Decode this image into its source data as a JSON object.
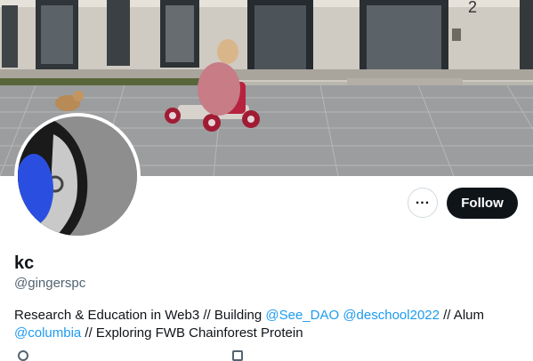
{
  "profile": {
    "display_name": "kc",
    "handle": "@gingerspc",
    "follow_label": "Follow",
    "more_label": "...",
    "bio": {
      "part1": "Research & Education in Web3 // Building ",
      "mention1": "@See_DAO",
      "space": " ",
      "mention2": "@deschool2022",
      "part2": " // Alum ",
      "mention3": "@columbia",
      "part3": " // Exploring FWB Chainforest Protein"
    }
  },
  "banner": {
    "building_number": "2"
  },
  "icons": {
    "more": "more-options-icon",
    "location": "location-icon",
    "calendar": "calendar-icon"
  },
  "colors": {
    "follow_bg": "#0f1419",
    "mention": "#1d9bf0",
    "handle": "#536471"
  }
}
